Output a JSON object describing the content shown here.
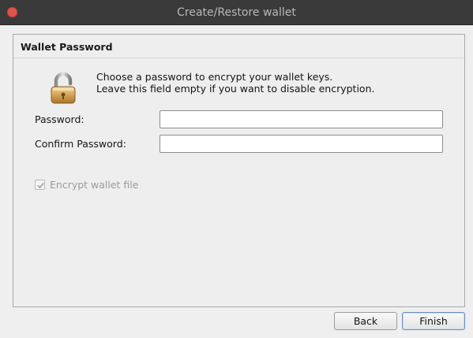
{
  "window": {
    "title": "Create/Restore wallet"
  },
  "panel": {
    "title": "Wallet Password",
    "icon": "padlock-open-icon",
    "description_line1": "Choose a password to encrypt your wallet keys.",
    "description_line2": "Leave this field empty if you want to disable encryption."
  },
  "form": {
    "password_label": "Password:",
    "password_value": "",
    "confirm_label": "Confirm Password:",
    "confirm_value": "",
    "encrypt_label": "Encrypt wallet file",
    "encrypt_checked": true,
    "encrypt_enabled": false
  },
  "buttons": {
    "back_label": "Back",
    "finish_label": "Finish"
  },
  "colors": {
    "titlebar": "#3a3a3a",
    "close": "#e5534b",
    "window_bg": "#efefef",
    "default_button_border": "#6b8fbf"
  }
}
